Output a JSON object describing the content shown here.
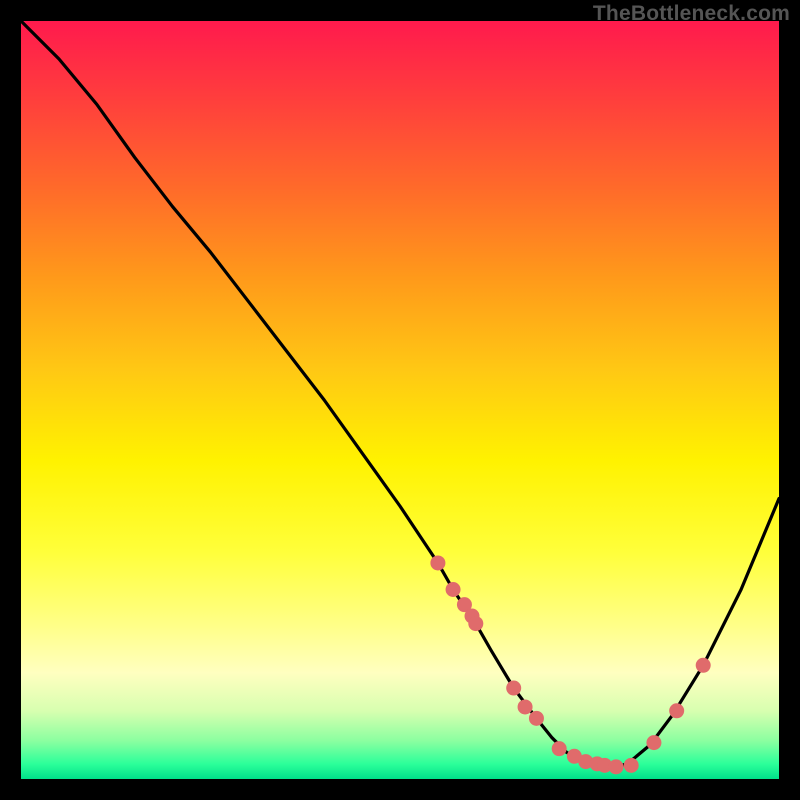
{
  "watermark": "TheBottleneck.com",
  "chart_data": {
    "type": "line",
    "title": "",
    "xlabel": "",
    "ylabel": "",
    "xlim": [
      0,
      100
    ],
    "ylim": [
      0,
      100
    ],
    "grid": false,
    "legend": false,
    "series": [
      {
        "name": "curve",
        "x": [
          0,
          5,
          10,
          15,
          20,
          25,
          30,
          35,
          40,
          45,
          50,
          55,
          57,
          60,
          62,
          65,
          68,
          70,
          72,
          75,
          78,
          80,
          83,
          86,
          90,
          95,
          100
        ],
        "y": [
          100,
          95,
          89,
          82,
          75.5,
          69.5,
          63,
          56.5,
          50,
          43,
          36,
          28.5,
          25,
          20.5,
          17,
          12,
          8,
          5.5,
          3.5,
          2,
          1.5,
          2,
          4.5,
          8.5,
          15,
          25,
          37
        ],
        "color": "#000000"
      },
      {
        "name": "dots",
        "x": [
          55,
          57,
          58.5,
          59.5,
          60,
          65,
          66.5,
          68,
          71,
          73,
          74.5,
          76,
          77,
          78.5,
          80.5,
          83.5,
          86.5,
          90
        ],
        "y": [
          28.5,
          25,
          23,
          21.5,
          20.5,
          12,
          9.5,
          8,
          4,
          3,
          2.3,
          2,
          1.8,
          1.6,
          1.8,
          4.8,
          9,
          15
        ],
        "color": "#e06b6b"
      }
    ],
    "gradient_background": {
      "top_color": "#ff1a4d",
      "bottom_color": "#00e08a"
    }
  }
}
